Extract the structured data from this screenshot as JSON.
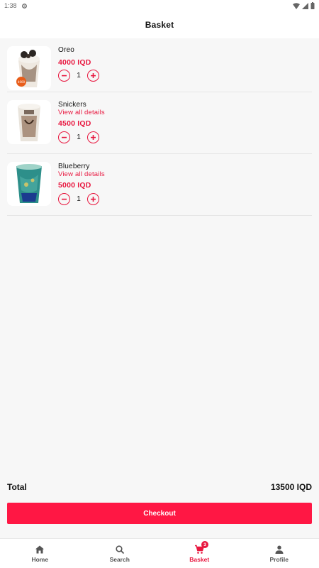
{
  "status_bar": {
    "time": "1:38"
  },
  "app_bar": {
    "title": "Basket"
  },
  "items": [
    {
      "name": "Oreo",
      "details": "",
      "price": "4000 IQD",
      "quantity": "1"
    },
    {
      "name": "Snickers",
      "details": "View all details",
      "price": "4500 IQD",
      "quantity": "1"
    },
    {
      "name": "Blueberry",
      "details": "View all details",
      "price": "5000 IQD",
      "quantity": "1"
    }
  ],
  "total": {
    "label": "Total",
    "value": "13500 IQD"
  },
  "checkout": {
    "label": "Checkout"
  },
  "bottom_nav": {
    "items": [
      {
        "label": "Home",
        "icon": "home-icon"
      },
      {
        "label": "Search",
        "icon": "search-icon"
      },
      {
        "label": "Basket",
        "icon": "cart-icon",
        "badge": "3",
        "active": true
      },
      {
        "label": "Profile",
        "icon": "person-icon"
      }
    ]
  },
  "colors": {
    "accent": "#e8173f",
    "checkout_bg": "#ff1744",
    "background": "#f7f7f7"
  }
}
